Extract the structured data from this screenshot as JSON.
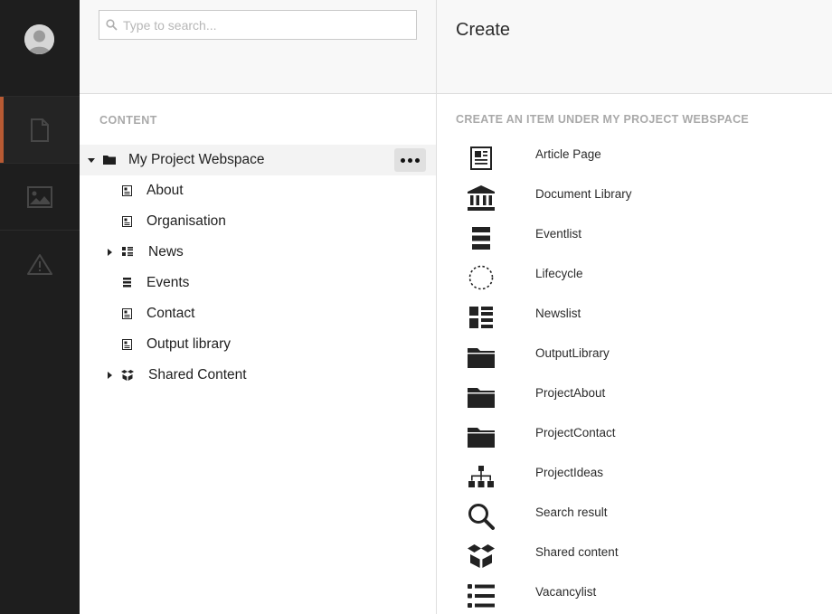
{
  "appbar": {
    "sections": [
      {
        "icon": "document-icon",
        "active": true
      },
      {
        "icon": "image-icon",
        "active": false
      },
      {
        "icon": "warning-icon",
        "active": false
      }
    ]
  },
  "search": {
    "placeholder": "Type to search...",
    "value": ""
  },
  "tree": {
    "section_label": "CONTENT",
    "root": {
      "label": "My Project Webspace",
      "more_label": "..."
    },
    "items": [
      {
        "label": "About",
        "icon": "document-icon"
      },
      {
        "label": "Organisation",
        "icon": "document-icon"
      },
      {
        "label": "News",
        "icon": "grid-list-icon"
      },
      {
        "label": "Events",
        "icon": "stack-icon"
      },
      {
        "label": "Contact",
        "icon": "document-icon"
      },
      {
        "label": "Output library",
        "icon": "document-icon"
      },
      {
        "label": "Shared Content",
        "icon": "box-icon"
      }
    ]
  },
  "create": {
    "title": "Create",
    "section_label": "CREATE AN ITEM UNDER MY PROJECT WEBSPACE",
    "items": [
      {
        "label": "Article Page",
        "icon": "article-icon"
      },
      {
        "label": "Document Library",
        "icon": "library-icon"
      },
      {
        "label": "Eventlist",
        "icon": "stack-icon"
      },
      {
        "label": "Lifecycle",
        "icon": "dashed-circle-icon"
      },
      {
        "label": "Newslist",
        "icon": "grid-list-icon"
      },
      {
        "label": "OutputLibrary",
        "icon": "folder-icon"
      },
      {
        "label": "ProjectAbout",
        "icon": "folder-icon"
      },
      {
        "label": "ProjectContact",
        "icon": "folder-icon"
      },
      {
        "label": "ProjectIdeas",
        "icon": "sitemap-icon"
      },
      {
        "label": "Search result",
        "icon": "search-icon"
      },
      {
        "label": "Shared content",
        "icon": "box-icon"
      },
      {
        "label": "Vacancylist",
        "icon": "list-icon"
      }
    ]
  }
}
